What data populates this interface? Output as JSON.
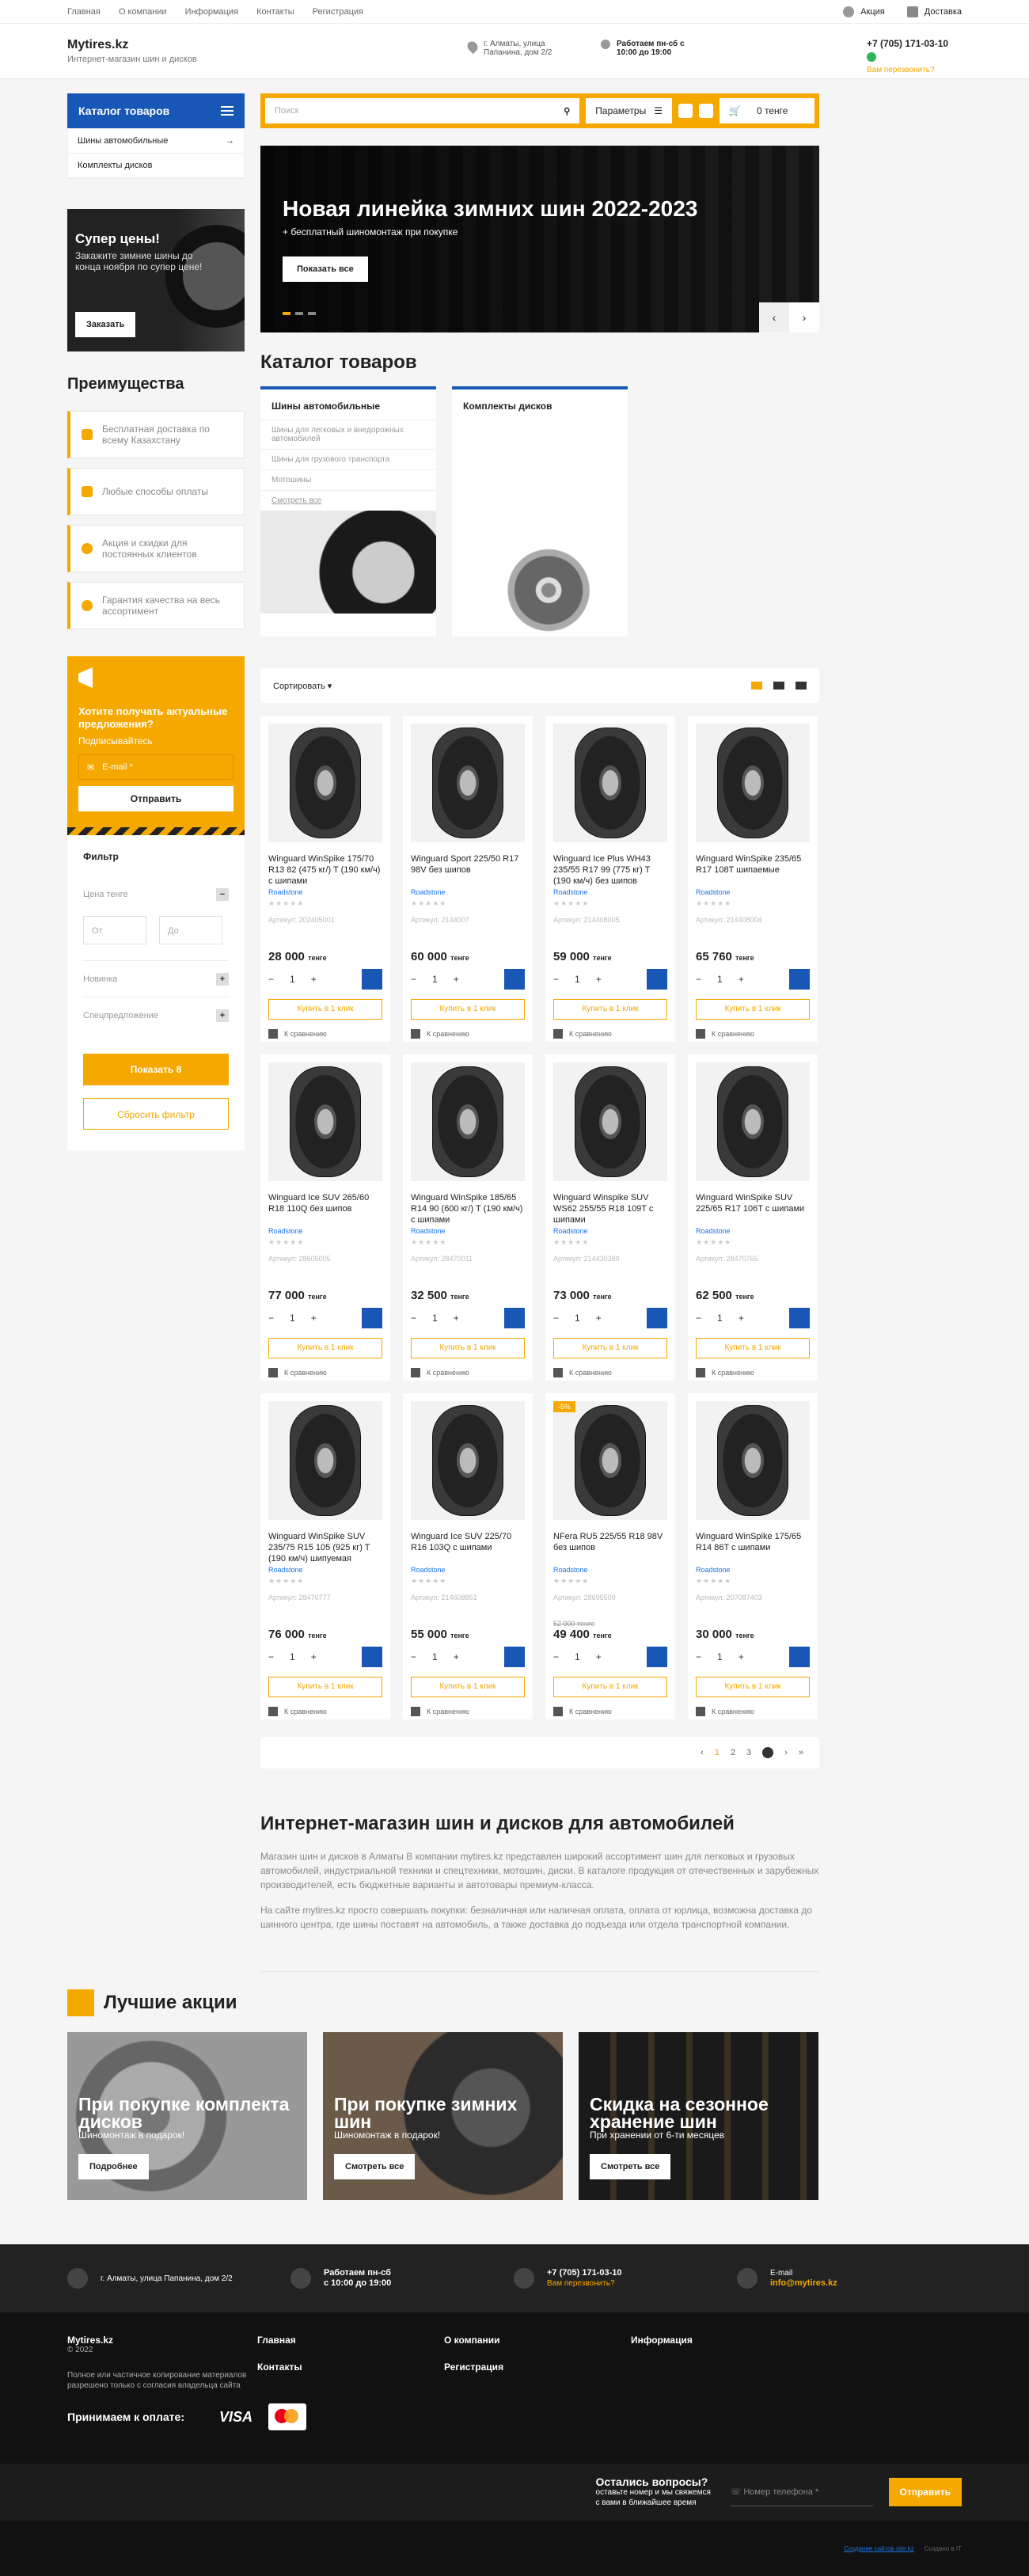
{
  "topbar": {
    "nav": [
      "Главная",
      "О компании",
      "Информация",
      "Контакты",
      "Регистрация"
    ],
    "actions": "Акция",
    "delivery": "Доставка"
  },
  "header": {
    "logo": "Mytires.kz",
    "tagline": "Интернет-магазин шин и дисков",
    "address": "г. Алматы, улица Папанина, дом 2/2",
    "hours": "Работаем пн-сб с 10:00 до 19:00",
    "phone": "+7 (705) 171-03-10",
    "callback": "Вам перезвонить?"
  },
  "catalog": {
    "title": "Каталог товаров",
    "items": [
      "Шины автомобильные",
      "Комплекты дисков"
    ]
  },
  "search": {
    "placeholder": "Поиск",
    "params": "Параметры",
    "cart": "0 тенге"
  },
  "superprice": {
    "title": "Супер цены!",
    "text": "Закажите зимние шины до конца ноября по супер цене!",
    "button": "Заказать"
  },
  "hero": {
    "title": "Новая линейка зимних шин 2022-2023",
    "subtitle": "+ бесплатный шиномонтаж при покупке",
    "button": "Показать все"
  },
  "advantages": {
    "title": "Преимущества",
    "items": [
      "Бесплатная доставка по всему Казахстану",
      "Любые способы оплаты",
      "Акция и скидки для постоянных клиентов",
      "Гарантия качества на весь ассортимент"
    ]
  },
  "subscribe": {
    "title": "Хотите получать актуальные предложения?",
    "lead": "Подписывайтесь",
    "email": "E-mail *",
    "button": "Отправить"
  },
  "filter": {
    "title": "Фильтр",
    "price": "Цена тенге",
    "from": "От",
    "to": "До",
    "new": "Новинка",
    "special": "Спецпредложение",
    "show": "Показать 8",
    "reset": "Сбросить фильтр"
  },
  "catalog_section": {
    "title": "Каталог товаров",
    "tires": {
      "title": "Шины автомобильные",
      "links": [
        "Шины для легковых и внедорожных автомобилей",
        "Шины для грузового транспорта",
        "Мотошины",
        "Смотреть все"
      ]
    },
    "disks": {
      "title": "Комплекты дисков"
    }
  },
  "sort": {
    "label": "Сортировать"
  },
  "product_common": {
    "stars": "★★★★★",
    "buy": "Купить в 1 клик",
    "compare": "К сравнению",
    "currency": "тенге",
    "qty": "1",
    "minus": "−",
    "plus": "+"
  },
  "products": [
    {
      "name": "Winguard WinSpike 175/70 R13 82 (475 кг/) T (190 км/ч) с шипами",
      "brand": "Roadstone",
      "sku": "Артикул: 202405001",
      "price": "28 000"
    },
    {
      "name": "Winguard Sport 225/50 R17 98V без шипов",
      "brand": "Roadstone",
      "sku": "Артикул: 2144007",
      "price": "60 000"
    },
    {
      "name": "Winguard Ice Plus WH43 235/55 R17 99 (775 кг) T (190 км/ч) без шипов",
      "brand": "Roadstone",
      "sku": "Артикул: 214408005",
      "price": "59 000"
    },
    {
      "name": "Winguard WinSpike 235/65 R17 108T шипаемые",
      "brand": "Roadstone",
      "sku": "Артикул: 214408004",
      "price": "65 760"
    },
    {
      "name": "Winguard Ice SUV 265/60 R18 110Q без шипов",
      "brand": "Roadstone",
      "sku": "Артикул: 28605005",
      "price": "77 000"
    },
    {
      "name": "Winguard WinSpike 185/65 R14 90 (600 кг/) T (190 км/ч) с шипами",
      "brand": "Roadstone",
      "sku": "Артикул: 28470011",
      "price": "32 500"
    },
    {
      "name": "Winguard Winspike SUV WS62 255/55 R18 109T с шипами",
      "brand": "Roadstone",
      "sku": "Артикул: 214430389",
      "price": "73 000"
    },
    {
      "name": "Winguard WinSpike SUV 225/65 R17 106T с шипами",
      "brand": "Roadstone",
      "sku": "Артикул: 28470765",
      "price": "62 500"
    },
    {
      "name": "Winguard WinSpike SUV 235/75 R15 105 (925 кг) T (190 км/ч) шипуемая",
      "brand": "Roadstone",
      "sku": "Артикул: 28470777",
      "price": "76 000"
    },
    {
      "name": "Winguard Ice SUV 225/70 R16 103Q с шипами",
      "brand": "Roadstone",
      "sku": "Артикул: 214608851",
      "price": "55 000"
    },
    {
      "name": "NFera RU5 225/55 R18 98V без шипов",
      "brand": "Roadstone",
      "sku": "Артикул: 28695509",
      "price": "49 400",
      "old": "52 000 тенге",
      "badge": "-5%"
    },
    {
      "name": "Winguard WinSpike 175/65 R14 86T с шипами",
      "brand": "Roadstone",
      "sku": "Артикул: 207087403",
      "price": "30 000"
    }
  ],
  "pager": {
    "prev": "‹",
    "pages": [
      "1",
      "2",
      "3"
    ],
    "next": "›",
    "last": "»"
  },
  "seo": {
    "title": "Интернет-магазин шин и дисков для автомобилей",
    "p1": "Магазин шин и дисков в Алматы В компании mytires.kz представлен широкий ассортимент шин для легковых и грузовых автомобилей, индустриальной техники и спецтехники, мотошин, диски. В каталоге продукция от отечественных и зарубежных производителей, есть бюджетные варианты и автотовары премиум-класса.",
    "p2": "На сайте mytires.kz просто совершать покупки: безналичная или наличная оплата, оплата от юрлица, возможна доставка до шинного центра, где шины поставят на автомобиль, а также доставка до подъезда или отдела транспортной компании."
  },
  "promos": {
    "title": "Лучшие акции",
    "items": [
      {
        "title": "При покупке комплекта дисков",
        "sub": "Шиномонтаж в подарок!",
        "button": "Подробнее"
      },
      {
        "title": "При покупке зимних шин",
        "sub": "Шиномонтаж в подарок!",
        "button": "Смотреть все"
      },
      {
        "title": "Скидка на сезонное хранение шин",
        "sub": "При хранении от 6-ти месяцев",
        "button": "Смотреть все"
      }
    ]
  },
  "footer": {
    "address": "г. Алматы, улица Папанина, дом 2/2",
    "hours1": "Работаем пн-сб",
    "hours2": "с 10:00 до 19:00",
    "phone": "+7 (705) 171-03-10",
    "callback": "Вам перезвонить?",
    "email_label": "E-mail",
    "email": "info@mytires.kz",
    "brand": "Mytires.kz",
    "year": "© 2022",
    "copy": "Полное или частичное копирование материалов разрешено только с согласия владельца сайта",
    "col2": [
      "Главная",
      "Контакты"
    ],
    "col3": [
      "О компании",
      "Регистрация"
    ],
    "col4": [
      "Информация"
    ],
    "pay": "Принимаем к оплате:",
    "visa": "VISA",
    "question": "Остались вопросы?",
    "qsub": "оставьте номер и мы свяжемся с вами в ближайшее время",
    "phone_ph": "Номер телефона *",
    "send": "Отправить",
    "dev": "Создание сайтов site.kz",
    "dev2": "· Создано в IT"
  },
  "colors": {
    "accent": "#f5a800",
    "primary": "#1857b5"
  }
}
